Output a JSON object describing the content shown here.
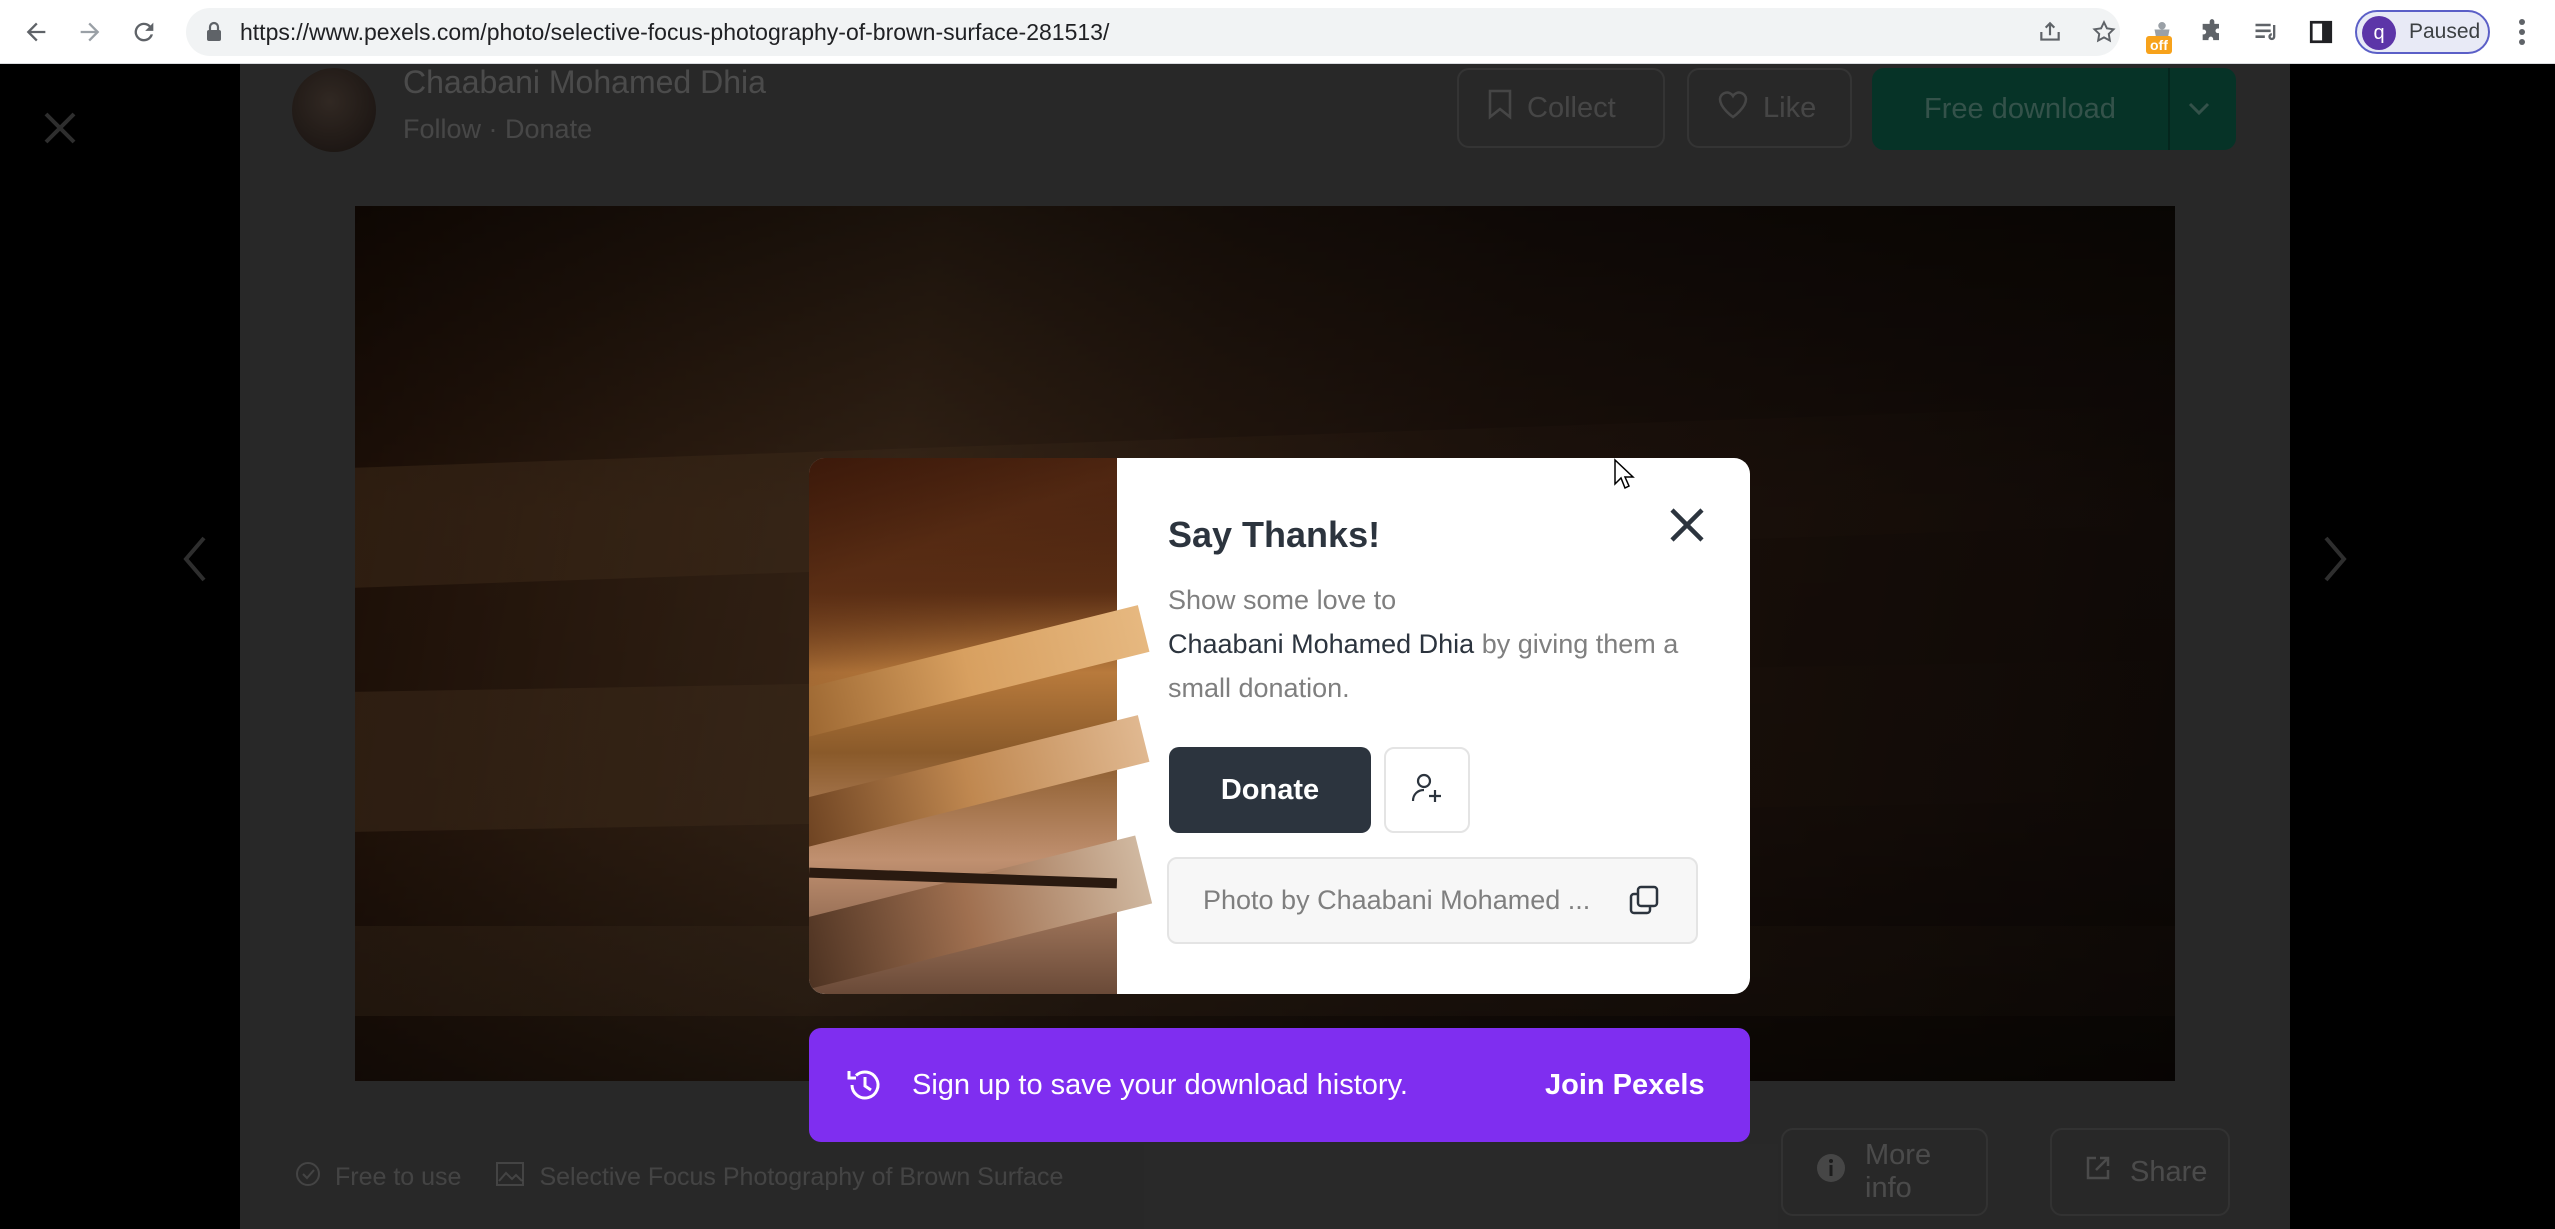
{
  "browser": {
    "url": "https://www.pexels.com/photo/selective-focus-photography-of-brown-surface-281513/",
    "extension_badge": "off",
    "profile_initial": "q",
    "profile_status": "Paused"
  },
  "header": {
    "author_name": "Chaabani Mohamed Dhia",
    "follow_label": "Follow",
    "separator": " · ",
    "donate_link_label": "Donate",
    "collect_label": "Collect",
    "like_label": "Like",
    "free_download_label": "Free download"
  },
  "footer": {
    "free_to_use_label": "Free to use",
    "photo_title": "Selective Focus Photography of Brown Surface",
    "more_info_label": "More info",
    "share_label": "Share"
  },
  "modal": {
    "title": "Say Thanks!",
    "text_before": "Show some love to",
    "text_author": "Chaabani Mohamed Dhia",
    "text_after": " by giving them a small donation.",
    "donate_button": "Donate",
    "credit_text": "Photo by Chaabani Mohamed ..."
  },
  "banner": {
    "message": "Sign up to save your download history.",
    "cta": "Join Pexels"
  },
  "colors": {
    "donate_button_bg": "#2c343e",
    "banner_bg": "#7f2ef0",
    "download_button_bg": "#05a081"
  }
}
